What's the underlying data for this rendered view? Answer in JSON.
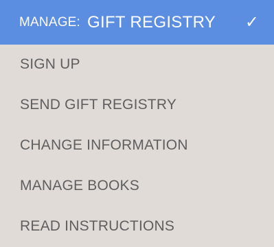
{
  "menu": {
    "header": {
      "prefix": "MANAGE:",
      "selected": "GIFT REGISTRY",
      "check_glyph": "✓",
      "check_icon": "checkmark-icon"
    },
    "items": [
      {
        "label": "SIGN UP"
      },
      {
        "label": "SEND GIFT REGISTRY"
      },
      {
        "label": "CHANGE INFORMATION"
      },
      {
        "label": "MANAGE BOOKS"
      },
      {
        "label": "READ INSTRUCTIONS"
      }
    ]
  },
  "colors": {
    "header_background": "#5b8de0",
    "header_text": "#ffffff",
    "menu_background": "#e1dbd8",
    "item_text": "#5f5f5f"
  }
}
